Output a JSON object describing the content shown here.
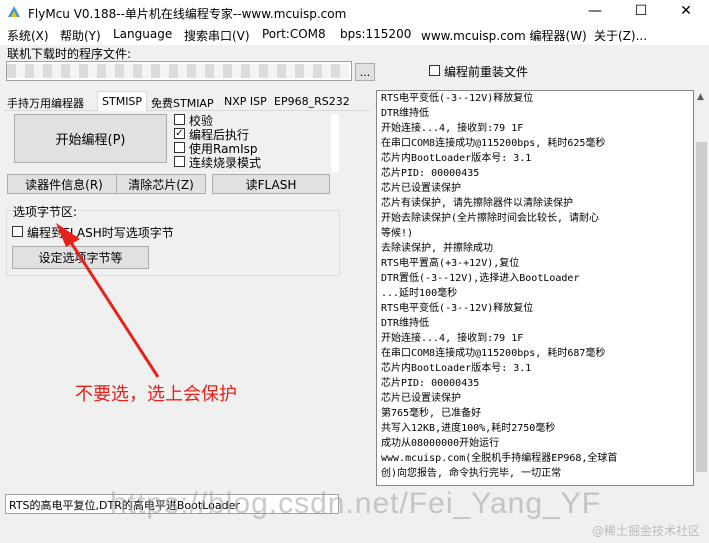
{
  "window": {
    "title": "FlyMcu V0.188--单片机在线编程专家--www.mcuisp.com",
    "minimize_glyph": "—",
    "maximize_glyph": "☐",
    "close_glyph": "✕"
  },
  "menu": [
    "系统(X)",
    "帮助(Y)",
    "Language",
    "搜索串口(V)",
    "Port:COM8",
    "bps:115200",
    "www.mcuisp.com 编程器(W)",
    "关于(Z)..."
  ],
  "file_section": {
    "label": "联机下载时的程序文件:",
    "path_value": "",
    "browse_label": "...",
    "reload_label": "编程前重装文件"
  },
  "tabs": [
    "手持万用编程器",
    "STMISP",
    "免费STMIAP",
    "NXP ISP",
    "EP968_RS232"
  ],
  "stmisp": {
    "start_button": "开始编程(P)",
    "checkboxes": [
      {
        "label": "校验",
        "checked": false
      },
      {
        "label": "编程后执行",
        "checked": true
      },
      {
        "label": "使用RamIsp",
        "checked": false
      },
      {
        "label": "连续烧录模式",
        "checked": false
      }
    ],
    "read_info_button": "读器件信息(R)",
    "erase_button": "清除芯片(Z)",
    "read_flash_button": "读FLASH",
    "option_group_label": "选项字节区:",
    "option_checkbox_label": "编程到FLASH时写选项字节",
    "option_checkbox_checked": false,
    "option_settings_button": "设定选项字节等"
  },
  "annotation": {
    "text": "不要选，选上会保护",
    "color": "#e8221a"
  },
  "bottom_dropdown": {
    "value": "RTS的高电平复位,DTR的高电平进BootLoader"
  },
  "log_lines": [
    "RTS电平变低(-3--12V)释放复位",
    "DTR维持低",
    "开始连接...4, 接收到:79 1F",
    "在串口COM8连接成功@115200bps, 耗时625毫秒",
    "芯片内BootLoader版本号: 3.1",
    "芯片PID: 00000435",
    "芯片已设置读保护",
    "芯片有读保护, 请先擦除器件以清除读保护",
    "开始去除读保护(全片擦除时间会比较长, 请耐心",
    "等候!)",
    "去除读保护, 并擦除成功",
    "RTS电平置高(+3-+12V),复位",
    "DTR置低(-3--12V),选择进入BootLoader",
    "...延时100毫秒",
    "RTS电平变低(-3--12V)释放复位",
    "DTR维持低",
    "开始连接...4, 接收到:79 1F",
    "在串口COM8连接成功@115200bps, 耗时687毫秒",
    "芯片内BootLoader版本号: 3.1",
    "芯片PID: 00000435",
    "芯片已设置读保护",
    "第765毫秒, 已准备好",
    "共写入12KB,进度100%,耗时2750毫秒",
    "成功从08000000开始运行",
    "www.mcuisp.com(全脱机手持编程器EP968,全球首",
    "创)向您报告, 命令执行完毕, 一切正常"
  ],
  "watermark": "https://blog.csdn.net/Fei_Yang_YF",
  "juejin_watermark": "@稀土掘金技术社区"
}
